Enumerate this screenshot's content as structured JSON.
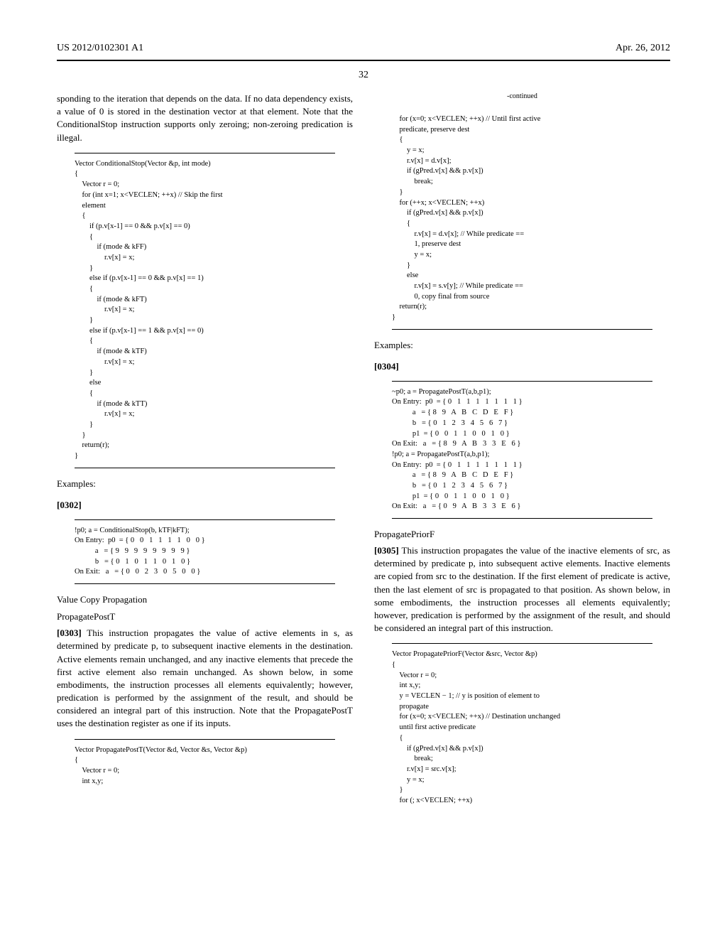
{
  "header": {
    "pub_number": "US 2012/0102301 A1",
    "date": "Apr. 26, 2012",
    "page_number": "32"
  },
  "col1": {
    "intro_para": "sponding to the iteration that depends on the data. If no data dependency exists, a value of 0 is stored in the destination vector at that element. Note that the ConditionalStop instruction supports only zeroing; non-zeroing predication is illegal.",
    "code1": "Vector ConditionalStop(Vector &p, int mode)\n{\n    Vector r = 0;\n    for (int x=1; x<VECLEN; ++x) // Skip the first\n    element\n    {\n        if (p.v[x-1] == 0 && p.v[x] == 0)\n        {\n            if (mode & kFF)\n                r.v[x] = x;\n        }\n        else if (p.v[x-1] == 0 && p.v[x] == 1)\n        {\n            if (mode & kFT)\n                r.v[x] = x;\n        }\n        else if (p.v[x-1] == 1 && p.v[x] == 0)\n        {\n            if (mode & kTF)\n                r.v[x] = x;\n        }\n        else\n        {\n            if (mode & kTT)\n                r.v[x] = x;\n        }\n    }\n    return(r);\n}",
    "examples_label": "Examples:",
    "para_0302": "[0302]",
    "example1": "!p0; a = ConditionalStop(b, kTF|kFT);\nOn Entry:  p0  = { 0   0   1   1   1   1   0   0 }\n           a   = { 9   9   9   9   9   9   9   9 }\n           b   = { 0   1   0   1   1   0   1   0 }\nOn Exit:   a   = { 0   0   2   3   0   5   0   0 }",
    "vcp_label": "Value Copy Propagation",
    "ppt_label": "PropagatePostT",
    "para_0303": "[0303]",
    "para_0303_text": "  This instruction propagates the value of active elements in s, as determined by predicate p, to subsequent inactive elements in the destination. Active elements remain unchanged, and any inactive elements that precede the first active element also remain unchanged. As shown below, in some embodiments, the instruction processes all elements equivalently; however, predication is performed by the assignment of the result, and should be considered an integral part of this instruction. Note that the PropagatePostT uses the destination register as one if its inputs.",
    "code2": "Vector PropagatePostT(Vector &d, Vector &s, Vector &p)\n{\n    Vector r = 0;\n    int x,y;"
  },
  "col2": {
    "continued_label": "-continued",
    "code_cont": "    for (x=0; x<VECLEN; ++x) // Until first active\n    predicate, preserve dest\n    {\n        y = x;\n        r.v[x] = d.v[x];\n        if (gPred.v[x] && p.v[x])\n            break;\n    }\n    for (++x; x<VECLEN; ++x)\n        if (gPred.v[x] && p.v[x])\n        {\n            r.v[x] = d.v[x]; // While predicate ==\n            1, preserve dest\n            y = x;\n        }\n        else\n            r.v[x] = s.v[y]; // While predicate ==\n            0, copy final from source\n    return(r);\n}",
    "examples_label": "Examples:",
    "para_0304": "[0304]",
    "example2": "~p0; a = PropagatePostT(a,b,p1);\nOn Entry:  p0  = { 0   1   1   1   1   1   1   1 }\n           a   = { 8   9   A   B   C   D   E   F }\n           b   = { 0   1   2   3   4   5   6   7 }\n           p1  = { 0   0   1   1   0   0   1   0 }\nOn Exit:   a   = { 8   9   A   B   3   3   E   6 }\n!p0; a = PropagatePostT(a,b,p1);\nOn Entry:  p0  = { 0   1   1   1   1   1   1   1 }\n           a   = { 8   9   A   B   C   D   E   F }\n           b   = { 0   1   2   3   4   5   6   7 }\n           p1  = { 0   0   1   1   0   0   1   0 }\nOn Exit:   a   = { 0   9   A   B   3   3   E   6 }",
    "ppf_label": "PropagatePriorF",
    "para_0305": "[0305]",
    "para_0305_text": "  This instruction propagates the value of the inactive elements of src, as determined by predicate p, into subsequent active elements. Inactive elements are copied from src to the destination. If the first element of predicate is active, then the last element of src is propagated to that position. As shown below, in some embodiments, the instruction processes all elements equivalently; however, predication is performed by the assignment of the result, and should be considered an integral part of this instruction.",
    "code3": "Vector PropagatePriorF(Vector &src, Vector &p)\n{\n    Vector r = 0;\n    int x,y;\n    y = VECLEN − 1; // y is position of element to\n    propagate\n    for (x=0; x<VECLEN; ++x) // Destination unchanged\n    until first active predicate\n    {\n        if (gPred.v[x] && p.v[x])\n            break;\n        r.v[x] = src.v[x];\n        y = x;\n    }\n    for (; x<VECLEN; ++x)"
  }
}
